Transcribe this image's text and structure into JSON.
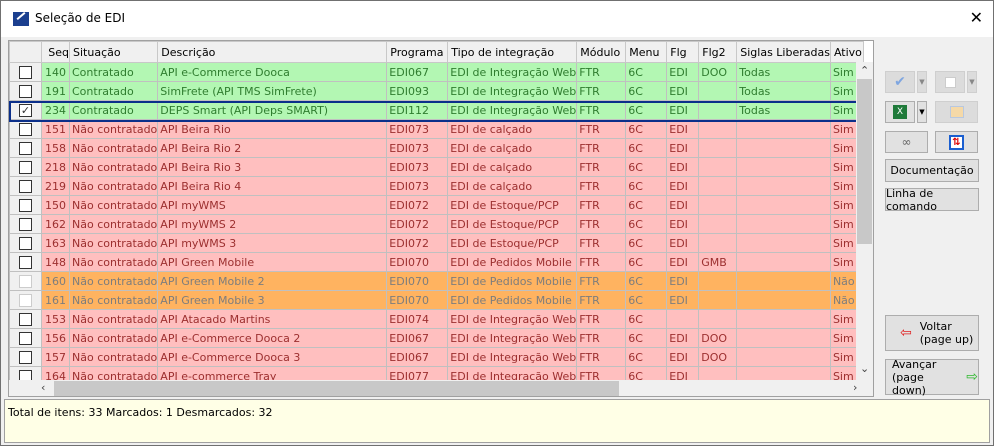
{
  "window": {
    "title": "Seleção de EDI",
    "close_icon": "close-icon"
  },
  "columns": [
    "",
    "Seq",
    "Situação",
    "Descrição",
    "Programa",
    "Tipo de integração",
    "Módulo",
    "Menu",
    "Flg",
    "Flg2",
    "Siglas Liberadas",
    "Ativo"
  ],
  "rows": [
    {
      "checked": false,
      "status": "green",
      "seq": "140",
      "situacao": "Contratado",
      "descricao": "API e-Commerce Dooca",
      "programa": "EDI067",
      "tipo": "EDI de Integração Web",
      "modulo": "FTR",
      "menu": "6C",
      "flg": "EDI",
      "flg2": "DOO",
      "siglas": "Todas",
      "ativo": "Sim"
    },
    {
      "checked": false,
      "status": "green",
      "seq": "191",
      "situacao": "Contratado",
      "descricao": "SimFrete (API TMS SimFrete)",
      "programa": "EDI093",
      "tipo": "EDI de Integração Web",
      "modulo": "FTR",
      "menu": "6C",
      "flg": "EDI",
      "flg2": "",
      "siglas": "Todas",
      "ativo": "Sim"
    },
    {
      "checked": true,
      "status": "green",
      "seq": "234",
      "situacao": "Contratado",
      "descricao": "DEPS Smart (API Deps SMART)",
      "programa": "EDI112",
      "tipo": "EDI de Integração Web",
      "modulo": "FTR",
      "menu": "6C",
      "flg": "EDI",
      "flg2": "",
      "siglas": "Todas",
      "ativo": "Sim"
    },
    {
      "checked": false,
      "status": "red",
      "seq": "151",
      "situacao": "Não contratado",
      "descricao": "API Beira Rio",
      "programa": "EDI073",
      "tipo": "EDI de calçado",
      "modulo": "FTR",
      "menu": "6C",
      "flg": "EDI",
      "flg2": "",
      "siglas": "",
      "ativo": "Sim"
    },
    {
      "checked": false,
      "status": "red",
      "seq": "158",
      "situacao": "Não contratado",
      "descricao": "API Beira Rio 2",
      "programa": "EDI073",
      "tipo": "EDI de calçado",
      "modulo": "FTR",
      "menu": "6C",
      "flg": "EDI",
      "flg2": "",
      "siglas": "",
      "ativo": "Sim"
    },
    {
      "checked": false,
      "status": "red",
      "seq": "218",
      "situacao": "Não contratado",
      "descricao": "API Beira Rio 3",
      "programa": "EDI073",
      "tipo": "EDI de calçado",
      "modulo": "FTR",
      "menu": "6C",
      "flg": "EDI",
      "flg2": "",
      "siglas": "",
      "ativo": "Sim"
    },
    {
      "checked": false,
      "status": "red",
      "seq": "219",
      "situacao": "Não contratado",
      "descricao": "API Beira Rio 4",
      "programa": "EDI073",
      "tipo": "EDI de calçado",
      "modulo": "FTR",
      "menu": "6C",
      "flg": "EDI",
      "flg2": "",
      "siglas": "",
      "ativo": "Sim"
    },
    {
      "checked": false,
      "status": "red",
      "seq": "150",
      "situacao": "Não contratado",
      "descricao": "API myWMS",
      "programa": "EDI072",
      "tipo": "EDI de Estoque/PCP",
      "modulo": "FTR",
      "menu": "6C",
      "flg": "EDI",
      "flg2": "",
      "siglas": "",
      "ativo": "Sim"
    },
    {
      "checked": false,
      "status": "red",
      "seq": "162",
      "situacao": "Não contratado",
      "descricao": "API myWMS 2",
      "programa": "EDI072",
      "tipo": "EDI de Estoque/PCP",
      "modulo": "FTR",
      "menu": "6C",
      "flg": "EDI",
      "flg2": "",
      "siglas": "",
      "ativo": "Sim"
    },
    {
      "checked": false,
      "status": "red",
      "seq": "163",
      "situacao": "Não contratado",
      "descricao": "API myWMS 3",
      "programa": "EDI072",
      "tipo": "EDI de Estoque/PCP",
      "modulo": "FTR",
      "menu": "6C",
      "flg": "EDI",
      "flg2": "",
      "siglas": "",
      "ativo": "Sim"
    },
    {
      "checked": false,
      "status": "red",
      "seq": "148",
      "situacao": "Não contratado",
      "descricao": "API Green Mobile",
      "programa": "EDI070",
      "tipo": "EDI de Pedidos Mobile",
      "modulo": "FTR",
      "menu": "6C",
      "flg": "EDI",
      "flg2": "GMB",
      "siglas": "",
      "ativo": "Sim"
    },
    {
      "checked": false,
      "status": "orange",
      "seq": "160",
      "situacao": "Não contratado",
      "descricao": "API Green Mobile 2",
      "programa": "EDI070",
      "tipo": "EDI de Pedidos Mobile",
      "modulo": "FTR",
      "menu": "6C",
      "flg": "EDI",
      "flg2": "",
      "siglas": "",
      "ativo": "Não"
    },
    {
      "checked": false,
      "status": "orange",
      "seq": "161",
      "situacao": "Não contratado",
      "descricao": "API Green Mobile 3",
      "programa": "EDI070",
      "tipo": "EDI de Pedidos Mobile",
      "modulo": "FTR",
      "menu": "6C",
      "flg": "EDI",
      "flg2": "",
      "siglas": "",
      "ativo": "Não"
    },
    {
      "checked": false,
      "status": "red",
      "seq": "153",
      "situacao": "Não contratado",
      "descricao": "API Atacado Martins",
      "programa": "EDI074",
      "tipo": "EDI de Integração Web",
      "modulo": "FTR",
      "menu": "6C",
      "flg": "",
      "flg2": "",
      "siglas": "",
      "ativo": "Sim"
    },
    {
      "checked": false,
      "status": "red",
      "seq": "156",
      "situacao": "Não contratado",
      "descricao": "API e-Commerce Dooca 2",
      "programa": "EDI067",
      "tipo": "EDI de Integração Web",
      "modulo": "FTR",
      "menu": "6C",
      "flg": "EDI",
      "flg2": "DOO",
      "siglas": "",
      "ativo": "Sim"
    },
    {
      "checked": false,
      "status": "red",
      "seq": "157",
      "situacao": "Não contratado",
      "descricao": "API e-Commerce Dooca 3",
      "programa": "EDI067",
      "tipo": "EDI de Integração Web",
      "modulo": "FTR",
      "menu": "6C",
      "flg": "EDI",
      "flg2": "DOO",
      "siglas": "",
      "ativo": "Sim"
    },
    {
      "checked": false,
      "status": "red",
      "seq": "164",
      "situacao": "Não contratado",
      "descricao": "API e-commerce Tray",
      "programa": "EDI077",
      "tipo": "EDI de Integração Web",
      "modulo": "FTR",
      "menu": "6C",
      "flg": "EDI",
      "flg2": "",
      "siglas": "",
      "ativo": "Sim"
    }
  ],
  "buttons": {
    "documentacao": "Documentação",
    "linha_comando": "Linha de comando",
    "voltar_1": "Voltar",
    "voltar_2": "(page up)",
    "avancar_1": "Avançar",
    "avancar_2": "(page down)"
  },
  "status_bar": "Total de itens: 33 Marcados: 1 Desmarcados: 32",
  "colors": {
    "contratado": "#b3f7b3",
    "nao_contratado": "#ffbfbf",
    "inativo": "#ffb360",
    "selection": "#0b2f8a"
  }
}
